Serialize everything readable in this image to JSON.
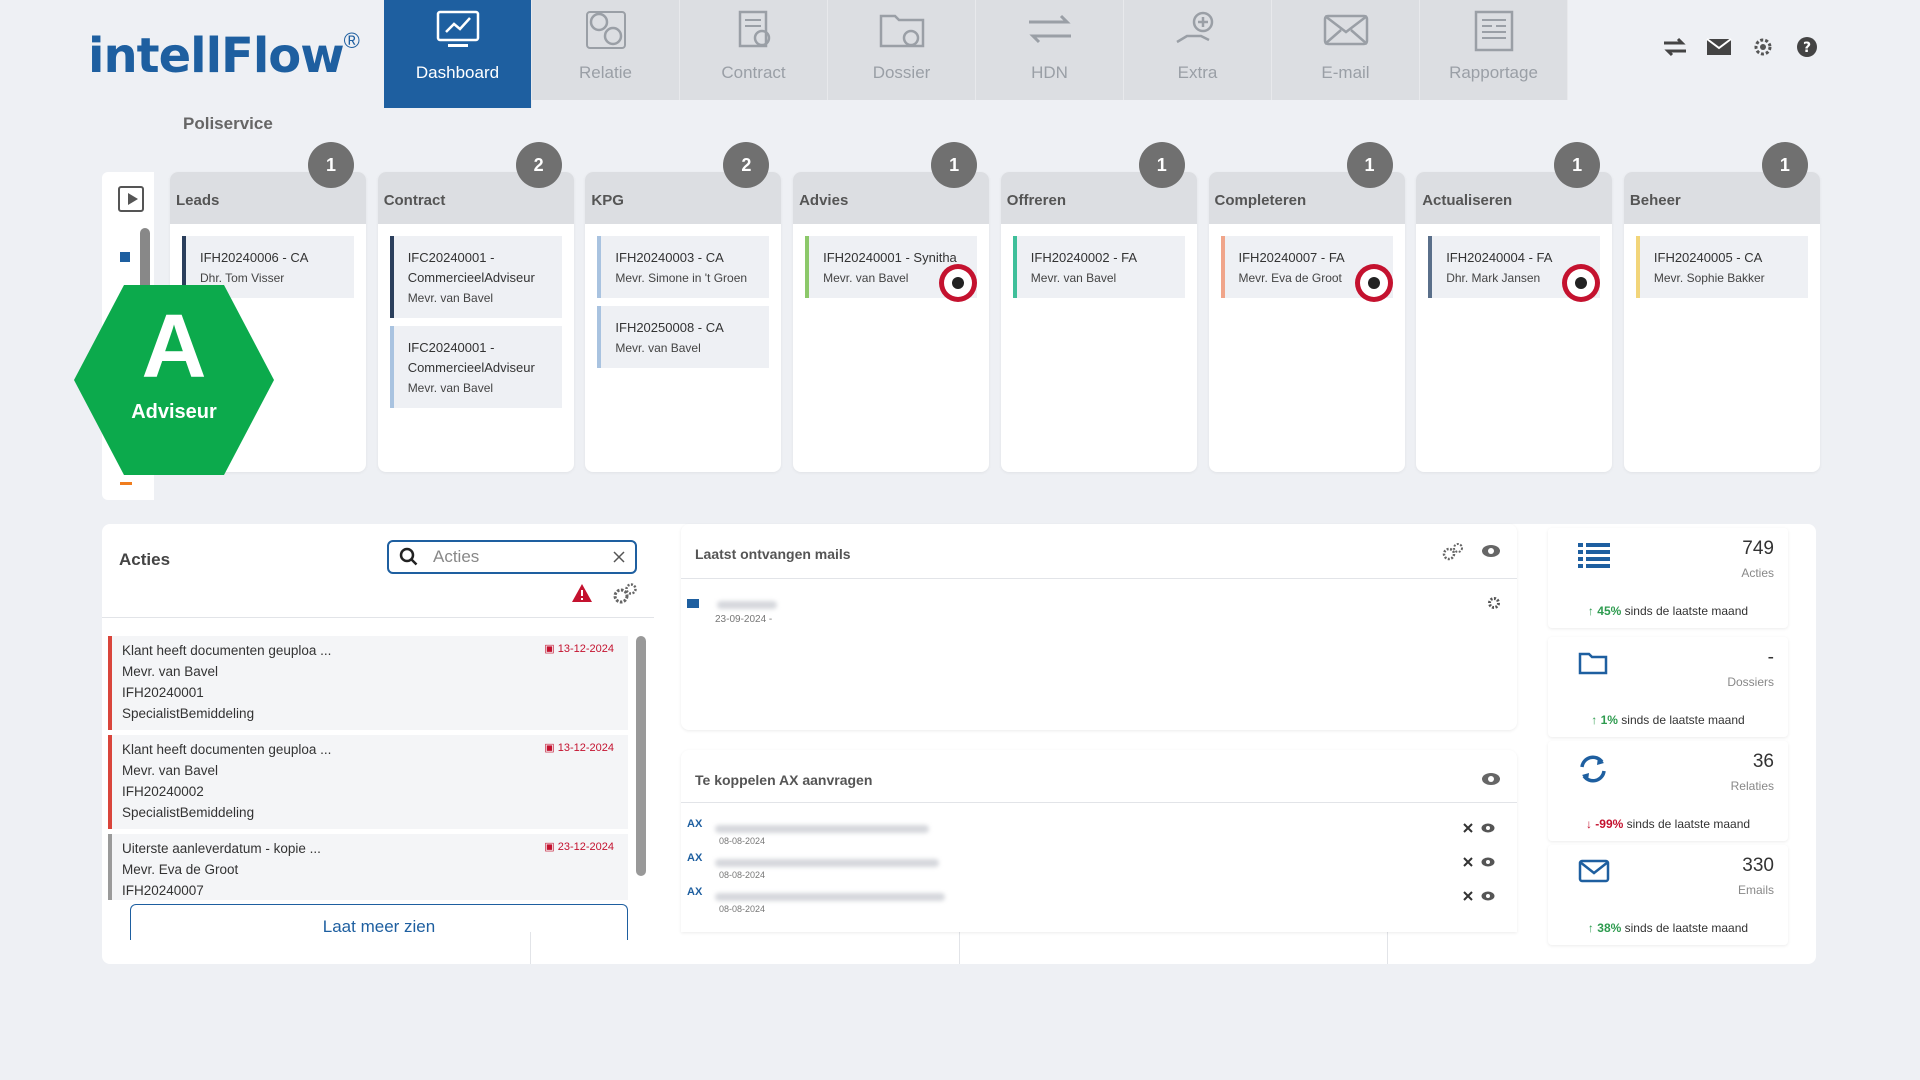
{
  "brand": {
    "name": "intellFlow",
    "reg": "®",
    "subtitle": "Poliservice"
  },
  "nav": [
    {
      "label": "Dashboard",
      "icon": "dashboard-icon",
      "active": true
    },
    {
      "label": "Relatie",
      "icon": "relatie-icon"
    },
    {
      "label": "Contract",
      "icon": "contract-icon"
    },
    {
      "label": "Dossier",
      "icon": "dossier-icon"
    },
    {
      "label": "HDN",
      "icon": "hdn-icon"
    },
    {
      "label": "Extra",
      "icon": "extra-icon"
    },
    {
      "label": "E-mail",
      "icon": "email-icon"
    },
    {
      "label": "Rapportage",
      "icon": "rapportage-icon"
    }
  ],
  "pipeline": [
    {
      "title": "Leads",
      "count": "1",
      "cards": [
        {
          "line1": "IFH20240006 - CA",
          "line2": "Dhr. Tom Visser",
          "color": "#2b3f5c"
        }
      ]
    },
    {
      "title": "Contract",
      "count": "2",
      "cards": [
        {
          "line1": "IFC20240001 -",
          "line1b": "CommercieelAdviseur",
          "line2": "Mevr. van Bavel",
          "color": "#2b3f5c"
        },
        {
          "line1": "IFC20240001 -",
          "line1b": "CommercieelAdviseur",
          "line2": "Mevr. van Bavel",
          "color": "#a9c3e0"
        }
      ]
    },
    {
      "title": "KPG",
      "count": "2",
      "cards": [
        {
          "line1": "IFH20240003 - CA",
          "line2": "Mevr. Simone in 't Groen",
          "color": "#a9c3e0"
        },
        {
          "line1": "IFH20250008 - CA",
          "line2": "Mevr. van Bavel",
          "color": "#a9c3e0"
        }
      ]
    },
    {
      "title": "Advies",
      "count": "1",
      "cards": [
        {
          "line1": "IFH20240001 - Synitha",
          "line2": "Mevr. van Bavel",
          "color": "#8cc86a",
          "target": true
        }
      ]
    },
    {
      "title": "Offreren",
      "count": "1",
      "cards": [
        {
          "line1": "IFH20240002 - FA",
          "line2": "Mevr. van Bavel",
          "color": "#3fbf9a"
        }
      ]
    },
    {
      "title": "Completeren",
      "count": "1",
      "cards": [
        {
          "line1": "IFH20240007 - FA",
          "line2": "Mevr. Eva de Groot",
          "color": "#f0a58a",
          "target": true
        }
      ]
    },
    {
      "title": "Actualiseren",
      "count": "1",
      "cards": [
        {
          "line1": "IFH20240004 - FA",
          "line2": "Dhr. Mark Jansen",
          "color": "#5a6f8a",
          "target": true
        }
      ]
    },
    {
      "title": "Beheer",
      "count": "1",
      "cards": [
        {
          "line1": "IFH20240005 - CA",
          "line2": "Mevr. Sophie Bakker",
          "color": "#f2d57a"
        }
      ]
    }
  ],
  "role_badge": {
    "letter": "A",
    "label": "Adviseur",
    "color": "#0caa4c"
  },
  "acties": {
    "title": "Acties",
    "search_placeholder": "Acties",
    "items": [
      {
        "title": "Klant heeft documenten geuploa ...",
        "client": "Mevr. van Bavel",
        "ref": "IFH20240001",
        "type": "SpecialistBemiddeling",
        "date": "13-12-2024",
        "urgent": true
      },
      {
        "title": "Klant heeft documenten geuploa ...",
        "client": "Mevr. van Bavel",
        "ref": "IFH20240002",
        "type": "SpecialistBemiddeling",
        "date": "13-12-2024",
        "urgent": true
      },
      {
        "title": "Uiterste aanleverdatum - kopie ...",
        "client": "Mevr. Eva de Groot",
        "ref": "IFH20240007",
        "type": "",
        "date": "23-12-2024",
        "urgent": false
      }
    ],
    "more_label": "Laat meer zien"
  },
  "mails": {
    "title": "Laatst ontvangen mails",
    "items": [
      {
        "date": "23-09-2024 -"
      }
    ]
  },
  "ax": {
    "title": "Te koppelen AX aanvragen",
    "items": [
      {
        "label": "AX",
        "date": "08-08-2024"
      },
      {
        "label": "AX",
        "date": "08-08-2024"
      },
      {
        "label": "AX",
        "date": "08-08-2024"
      }
    ]
  },
  "stats": [
    {
      "value": "749",
      "label": "Acties",
      "change": "45%",
      "dir": "up",
      "suffix": "sinds de laatste maand",
      "icon": "list-icon"
    },
    {
      "value": "-",
      "label": "Dossiers",
      "change": "1%",
      "dir": "up",
      "suffix": "sinds de laatste maand",
      "icon": "folder-icon"
    },
    {
      "value": "36",
      "label": "Relaties",
      "change": "-99%",
      "dir": "down",
      "suffix": "sinds de laatste maand",
      "icon": "refresh-icon"
    },
    {
      "value": "330",
      "label": "Emails",
      "change": "38%",
      "dir": "up",
      "suffix": "sinds de laatste maand",
      "icon": "envelope-icon"
    }
  ]
}
